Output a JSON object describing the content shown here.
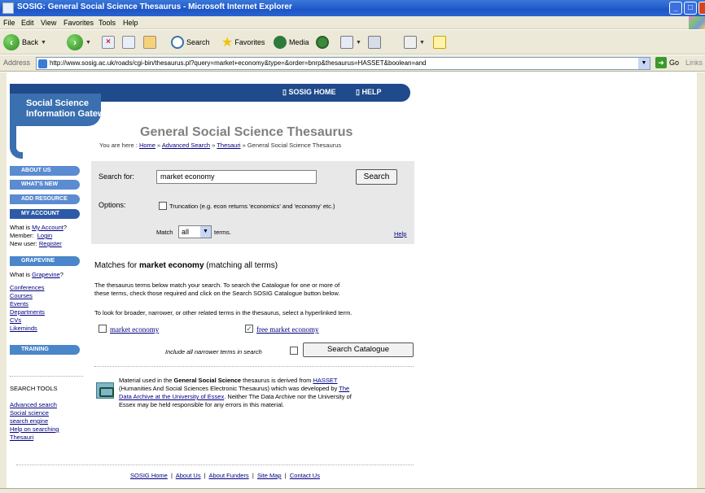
{
  "window": {
    "title": "SOSIG: General Social Science Thesaurus - Microsoft Internet Explorer"
  },
  "menu": [
    "File",
    "Edit",
    "View",
    "Favorites",
    "Tools",
    "Help"
  ],
  "toolbar": {
    "back": "Back",
    "search": "Search",
    "favorites": "Favorites",
    "media": "Media"
  },
  "address": {
    "label": "Address",
    "url": "http://www.sosig.ac.uk/roads/cgi-bin/thesaurus.pl?query=market+economy&type=&order=bnrp&thesaurus=HASSET&boolean=and",
    "go": "Go",
    "links": "Links"
  },
  "site": {
    "brand_line1": "Social Science",
    "brand_line2": "Information Gateway",
    "nav_home": "SOSIG HOME",
    "nav_help": "HELP",
    "page_title": "General Social Science Thesaurus",
    "breadcrumb": {
      "prefix": "You are here :",
      "home": "Home",
      "advanced": "Advanced Search",
      "thesauri": "Thesauri",
      "current": "General Social Science Thesaurus"
    }
  },
  "sidebar": {
    "about_us": "ABOUT US",
    "whats_new": "WHAT'S NEW",
    "add_resource": "ADD RESOURCE",
    "my_account": "MY ACCOUNT",
    "what_is_prefix": "What is",
    "my_account_link": "My Account",
    "member_label": "Member:",
    "login": "Login",
    "new_user_label": "New user:",
    "register": "Register",
    "grapevine": "GRAPEVINE",
    "grapevine_link": "Grapevine",
    "grapevine_items": [
      "Conferences",
      "Courses",
      "Events",
      "Departments",
      "CVs",
      "Likeminds"
    ],
    "training": "TRAINING",
    "search_tools_heading": "SEARCH TOOLS",
    "search_tools": [
      "Advanced search",
      "Social science",
      "search engine",
      "Help on searching",
      "Thesauri"
    ]
  },
  "search": {
    "label": "Search for:",
    "value": "market economy",
    "button": "Search",
    "options_label": "Options:",
    "truncation_label": "Truncation (e.g. econ returns 'economics' and 'economy' etc.)",
    "match_label": "Match",
    "match_value": "all",
    "terms_label": "terms.",
    "help": "Help"
  },
  "results": {
    "heading_prefix": "Matches for ",
    "heading_query": "market economy",
    "heading_suffix": " (matching all terms)",
    "para1_line1": "The thesaurus terms below match your search. To search the Catalogue for one or more of",
    "para1_line2": "these terms, check those required and click on the Search SOSIG Catalogue button below.",
    "para2": "To look for broader, narrower, or other related terms in the thesaurus, select a hyperlinked term.",
    "terms": [
      {
        "label": "market economy",
        "checked": false
      },
      {
        "label": "free market economy",
        "checked": true
      }
    ],
    "narrower_label": "Include all narrower terms in search",
    "catalogue_button": "Search Catalogue"
  },
  "footer_note": {
    "line1_pre": "Material used in the ",
    "line1_bold": "General Social Science",
    "line1_mid": " thesaurus is derived from ",
    "hasset": "HASSET",
    "line2_pre": "(Humanities And Social Sciences Electronic Thesaurus) which was developed by ",
    "line2_link": "The",
    "line3_link": "Data Archive at the University of Essex",
    "line3_post": ". Neither The Data Archive nor the University of",
    "line4": "Essex may be held responsible for any errors in this material."
  },
  "footer_links": [
    "SOSIG Home",
    "About Us",
    "About Funders",
    "Site Map",
    "Contact Us"
  ]
}
